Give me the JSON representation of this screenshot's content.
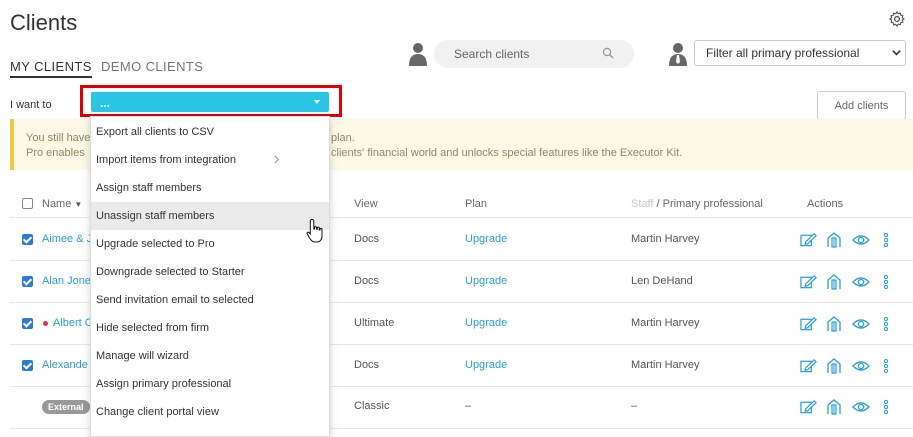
{
  "page": {
    "title": "Clients"
  },
  "tabs": [
    {
      "label": "MY CLIENTS",
      "active": true
    },
    {
      "label": "DEMO CLIENTS",
      "active": false
    }
  ],
  "search": {
    "placeholder": "Search clients"
  },
  "filter": {
    "selected": "Filter all primary professional"
  },
  "action_bar": {
    "label": "I want to",
    "selected": "...",
    "add_button": "Add clients"
  },
  "notice": {
    "line1": "You still have",
    "line1_tail": "plan.",
    "line2": "Pro enables",
    "line2_tail": "clients' financial world and unlocks special features like the Executor Kit."
  },
  "table": {
    "headers": {
      "name": "Name",
      "view": "View",
      "plan": "Plan",
      "staff": "Staff",
      "sep": " / ",
      "primary": "Primary professional",
      "actions": "Actions"
    },
    "rows": [
      {
        "checked": true,
        "name": "Aimee & J",
        "view": "Docs",
        "plan": "Upgrade",
        "professional": "Martin Harvey",
        "flagged": false
      },
      {
        "checked": true,
        "name": "Alan Jone",
        "view": "Docs",
        "plan": "Upgrade",
        "professional": "Len DeHand",
        "flagged": false
      },
      {
        "checked": true,
        "name": "Albert C",
        "view": "Ultimate",
        "plan": "Upgrade",
        "professional": "Martin Harvey",
        "flagged": true
      },
      {
        "checked": true,
        "name": "Alexande",
        "view": "Docs",
        "plan": "Upgrade",
        "professional": "Martin Harvey",
        "flagged": false
      },
      {
        "checked": false,
        "badge": "External",
        "view": "Classic",
        "plan": "–",
        "professional": "–"
      }
    ]
  },
  "dropdown": {
    "items": [
      {
        "label": "Export all clients to CSV"
      },
      {
        "label": "Import items from integration",
        "submenu": true
      },
      {
        "label": "Assign staff members"
      },
      {
        "label": "Unassign staff members",
        "highlighted": true
      },
      {
        "label": "Upgrade selected to Pro"
      },
      {
        "label": "Downgrade selected to Starter"
      },
      {
        "label": "Send invitation email to selected"
      },
      {
        "label": "Hide selected from firm"
      },
      {
        "label": "Manage will wizard"
      },
      {
        "label": "Assign primary professional"
      },
      {
        "label": "Change client portal view"
      }
    ]
  },
  "colors": {
    "accent": "#29c5e6",
    "link": "#2a9fd6",
    "checkbox": "#2a7bd6",
    "highlight_box": "#e00000",
    "notice_border": "#f5c342"
  },
  "icons": [
    "gear-icon",
    "person-icon",
    "search-icon",
    "chevron-down-icon",
    "edit-icon",
    "building-icon",
    "eye-icon",
    "more-vertical-icon",
    "chevron-right-icon",
    "hand-cursor-icon"
  ]
}
